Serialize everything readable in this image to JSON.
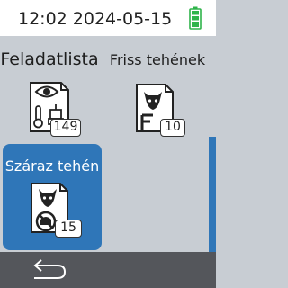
{
  "status": {
    "datetime": "12:02 2024-05-15",
    "battery_icon": "battery-full-icon",
    "battery_color": "#2fb44a"
  },
  "tiles": [
    {
      "label": "Feladatlista",
      "icon": "task-list-icon",
      "count": "149"
    },
    {
      "label": "Friss tehének",
      "icon": "fresh-cows-icon",
      "count": "10"
    },
    {
      "label": "Száraz tehén",
      "icon": "dry-cow-icon",
      "count": "15",
      "selected": true
    }
  ],
  "footer": {
    "back_icon": "back-arrow-icon"
  },
  "colors": {
    "accent": "#2f76b8",
    "footer": "#54565b",
    "background": "#c8cdd3"
  }
}
